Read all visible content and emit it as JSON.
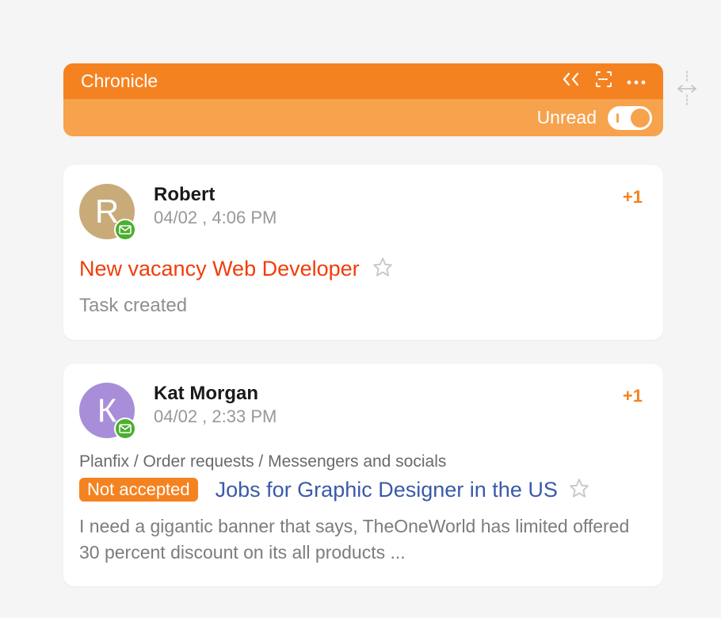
{
  "header": {
    "title": "Chronicle",
    "unread_label": "Unread"
  },
  "cards": [
    {
      "avatar_initial": "R",
      "name": "Robert",
      "timestamp": "04/02 , 4:06 PM",
      "counter": "+1",
      "title": "New vacancy Web Developer",
      "subtext": "Task created"
    },
    {
      "avatar_initial": "К",
      "name": "Kat Morgan",
      "timestamp": "04/02 , 2:33 PM",
      "counter": "+1",
      "breadcrumb": "Planfix / Order requests / Messengers and socials",
      "tag": "Not accepted",
      "title": "Jobs for Graphic Designer in the US",
      "snippet": "I need a gigantic banner that says, TheOneWorld has limited offered 30 percent discount on its all products ..."
    }
  ]
}
